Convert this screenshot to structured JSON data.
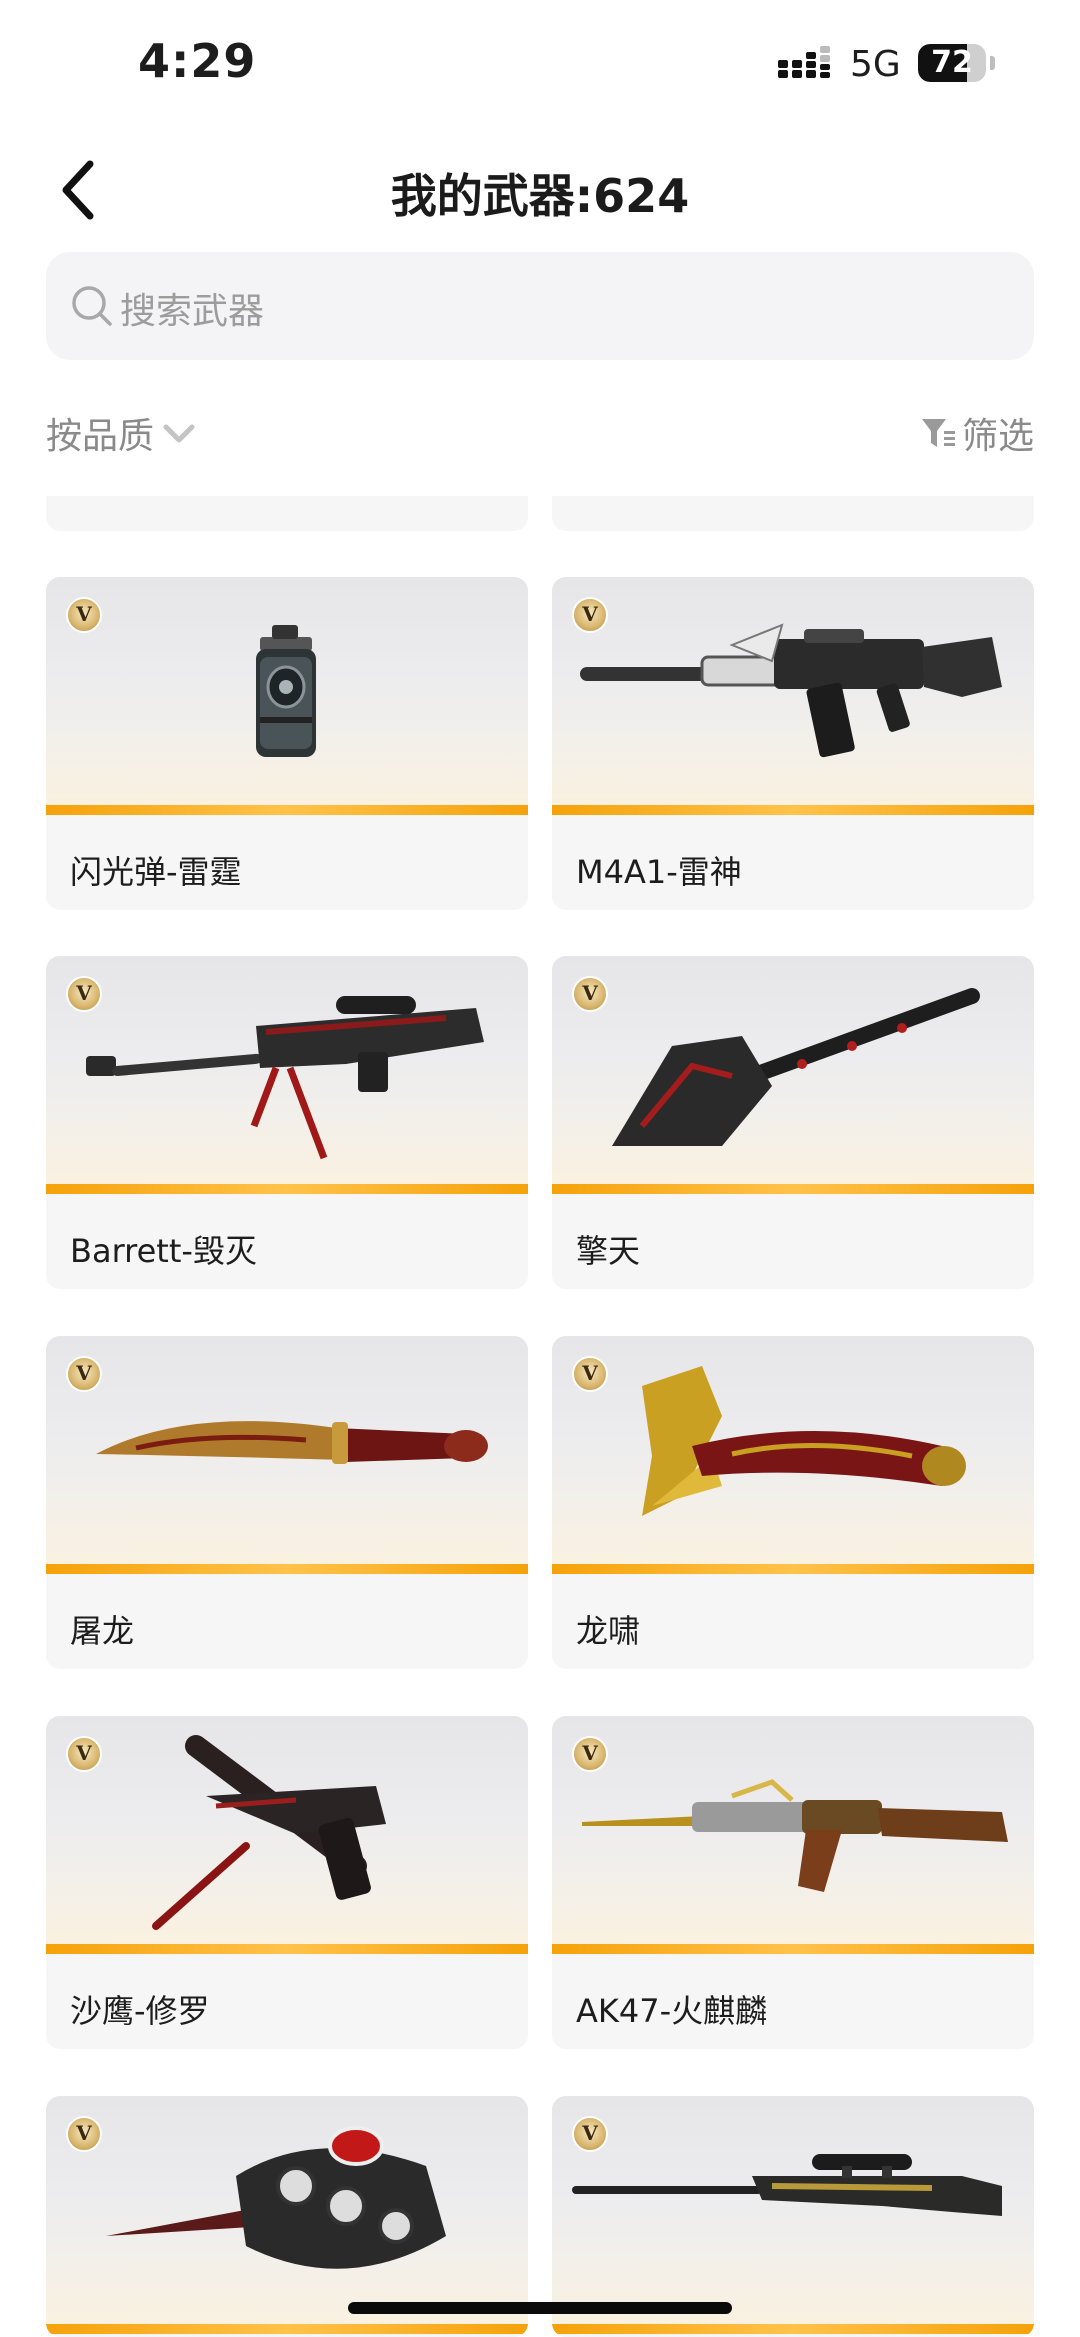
{
  "status_bar": {
    "time": "4:29",
    "network": "5G",
    "battery": "72",
    "battery_level": 0.72
  },
  "header": {
    "title": "我的武器:624",
    "back_icon": "chevron-left-icon"
  },
  "search": {
    "placeholder": "搜索武器",
    "icon": "search-icon"
  },
  "toolbar": {
    "sort_label": "按品质",
    "sort_icon": "chevron-down-icon",
    "filter_label": "筛选",
    "filter_icon": "filter-icon"
  },
  "weapons": [
    {
      "name": "闪光弹-雷霆",
      "badge": "V",
      "icon": "grenade-icon"
    },
    {
      "name": "M4A1-雷神",
      "badge": "V",
      "icon": "assault-rifle-icon"
    },
    {
      "name": "Barrett-毁灭",
      "badge": "V",
      "icon": "sniper-rifle-icon"
    },
    {
      "name": "擎天",
      "badge": "V",
      "icon": "shovel-icon"
    },
    {
      "name": "屠龙",
      "badge": "V",
      "icon": "machete-icon"
    },
    {
      "name": "龙啸",
      "badge": "V",
      "icon": "dragon-axe-icon"
    },
    {
      "name": "沙鹰-修罗",
      "badge": "V",
      "icon": "pistol-icon"
    },
    {
      "name": "AK47-火麒麟",
      "badge": "V",
      "icon": "ak47-icon"
    },
    {
      "name": "",
      "badge": "V",
      "icon": "knuckle-blade-icon"
    },
    {
      "name": "",
      "badge": "V",
      "icon": "awp-rifle-icon"
    }
  ],
  "colors": {
    "accent_bar": "#f5a20a",
    "card_bg": "#f6f6f7",
    "muted_text": "#8a8a8a"
  }
}
